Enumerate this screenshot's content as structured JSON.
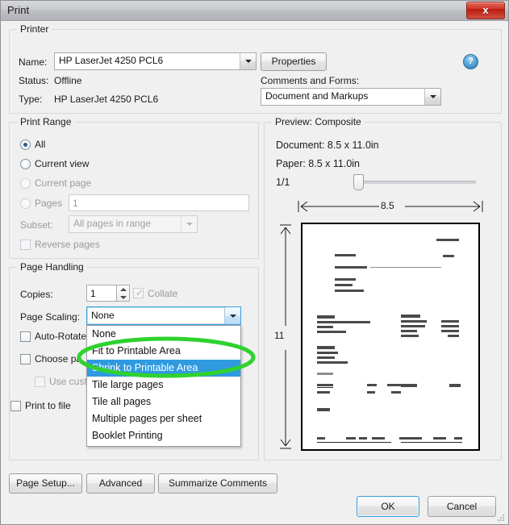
{
  "window": {
    "title": "Print",
    "close_label": "x"
  },
  "printer": {
    "group_title": "Printer",
    "name_label": "Name:",
    "name_value": "HP LaserJet 4250 PCL6",
    "properties_button": "Properties",
    "status_label": "Status:",
    "status_value": "Offline",
    "type_label": "Type:",
    "type_value": "HP LaserJet 4250 PCL6",
    "comments_label": "Comments and Forms:",
    "comments_value": "Document and Markups",
    "help_glyph": "?"
  },
  "print_range": {
    "group_title": "Print Range",
    "options": [
      {
        "label": "All",
        "selected": true,
        "enabled": true
      },
      {
        "label": "Current view",
        "selected": false,
        "enabled": true
      },
      {
        "label": "Current page",
        "selected": false,
        "enabled": false
      },
      {
        "label": "Pages",
        "selected": false,
        "enabled": false
      }
    ],
    "pages_value": "1",
    "subset_label": "Subset:",
    "subset_value": "All pages in range",
    "reverse_pages_label": "Reverse pages",
    "reverse_pages_checked": false
  },
  "page_handling": {
    "group_title": "Page Handling",
    "copies_label": "Copies:",
    "copies_value": "1",
    "collate_label": "Collate",
    "collate_checked": true,
    "page_scaling_label": "Page Scaling:",
    "page_scaling_value": "None",
    "auto_rotate_label": "Auto-Rotate",
    "auto_rotate_checked": false,
    "choose_paper_label": "Choose pa",
    "choose_paper_checked": false,
    "use_custom_label": "Use custo",
    "use_custom_checked": false,
    "print_to_file_label": "Print to file",
    "print_to_file_checked": false,
    "scaling_options": [
      {
        "label": "None",
        "selected": false
      },
      {
        "label": "Fit to Printable Area",
        "selected": false
      },
      {
        "label": "Shrink to Printable Area",
        "selected": true
      },
      {
        "label": "Tile large pages",
        "selected": false
      },
      {
        "label": "Tile all pages",
        "selected": false
      },
      {
        "label": "Multiple pages per sheet",
        "selected": false
      },
      {
        "label": "Booklet Printing",
        "selected": false
      }
    ]
  },
  "preview": {
    "group_title": "Preview: Composite",
    "document_size": "Document: 8.5 x 11.0in",
    "paper_size": "Paper: 8.5 x 11.0in",
    "page_indicator": "1/1",
    "width_dimension": "8.5",
    "height_dimension": "11"
  },
  "footer": {
    "page_setup_button": "Page Setup...",
    "advanced_button": "Advanced",
    "summarize_button": "Summarize Comments",
    "ok_button": "OK",
    "cancel_button": "Cancel"
  },
  "annotation": {
    "shape": "ellipse",
    "color": "#2fd22f",
    "target": "Shrink to Printable Area"
  },
  "colors": {
    "highlight": "#2f9ae0",
    "annotation_green": "#2fd22f",
    "dialog_bg": "#f0f0f0",
    "close_red": "#cf2a19"
  }
}
